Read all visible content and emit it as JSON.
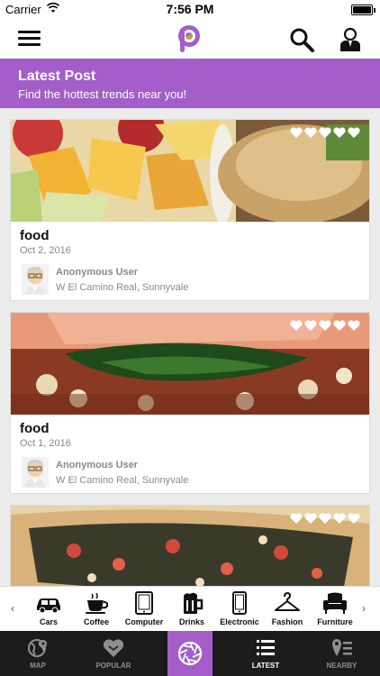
{
  "status_bar": {
    "carrier": "Carrier",
    "time": "7:56 PM",
    "battery_level": 1.0
  },
  "navbar": {
    "logo_icon": "p-logo-icon",
    "menu_icon": "hamburger-menu-icon",
    "search_icon": "search-icon",
    "profile_icon": "user-profile-icon"
  },
  "header": {
    "title": "Latest Post",
    "subtitle": "Find the hottest trends near you!"
  },
  "posts": [
    {
      "title": "food",
      "date": "Oct 2, 2016",
      "author": "Anonymous User",
      "location": "W El Camino Real, Sunnyvale",
      "rating_hearts": 5
    },
    {
      "title": "food",
      "date": "Oct 1, 2016",
      "author": "Anonymous User",
      "location": "W El Camino Real, Sunnyvale",
      "rating_hearts": 5
    },
    {
      "rating_hearts": 5
    }
  ],
  "categories": [
    {
      "label": "Cars",
      "icon": "car-icon"
    },
    {
      "label": "Coffee",
      "icon": "coffee-cup-icon"
    },
    {
      "label": "Computer",
      "icon": "tablet-icon"
    },
    {
      "label": "Drinks",
      "icon": "beer-mug-icon"
    },
    {
      "label": "Electronic",
      "icon": "phone-icon"
    },
    {
      "label": "Fashion",
      "icon": "hanger-icon"
    },
    {
      "label": "Furniture",
      "icon": "armchair-icon"
    }
  ],
  "tabs": [
    {
      "label": "MAP",
      "icon": "globe-icon"
    },
    {
      "label": "POPULAR",
      "icon": "heart-badge-icon"
    },
    {
      "label": "",
      "icon": "camera-shutter-icon"
    },
    {
      "label": "LATEST",
      "icon": "list-icon",
      "active": true
    },
    {
      "label": "NEARBY",
      "icon": "location-pin-list-icon"
    }
  ],
  "colors": {
    "accent": "#a35ec9",
    "tabbar": "#1c1c1c",
    "background": "#ececec"
  }
}
